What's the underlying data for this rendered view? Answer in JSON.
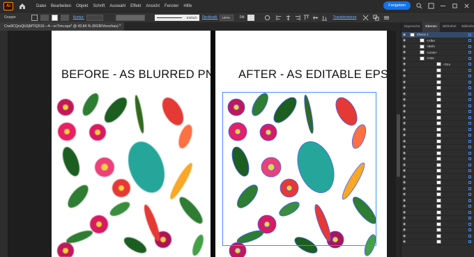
{
  "app": {
    "logo": "Ai"
  },
  "menu": [
    "Datei",
    "Bearbeiten",
    "Objekt",
    "Schrift",
    "Auswahl",
    "Effekt",
    "Ansicht",
    "Fenster",
    "Hilfe"
  ],
  "toolbar_right": {
    "share_label": "Freigeben"
  },
  "control": {
    "group_label": "Gruppe",
    "contour_label": "Kontur:",
    "stroke_label": "Einfach",
    "opacity_label": "Deckkraft:",
    "opacity_value": "100%",
    "style_label": "Stil:",
    "transform_label": "Transformieren"
  },
  "document": {
    "tab_title": "Crw9CQrsQiUIjMTIQ516---4---vcTmv.eps* @ 43.84 % (RGB/Vorschau)",
    "close": "×"
  },
  "artboards": {
    "left_title": "BEFORE - AS BLURRED PNG",
    "right_title": "AFTER - AS EDITABLE EPS"
  },
  "panel": {
    "tabs": [
      "Eigenscha",
      "Ebenen",
      "Bibliothel",
      "Bibliothe"
    ],
    "active_tab": 1,
    "layers": [
      {
        "label": "Ebene 1",
        "top": true
      },
      {
        "label": "<After"
      },
      {
        "label": "<Befo"
      },
      {
        "label": "<Linie>"
      },
      {
        "label": "<Hint"
      },
      {
        "label": "<Gru"
      },
      {
        "label": ""
      },
      {
        "label": ""
      },
      {
        "label": ""
      },
      {
        "label": ""
      },
      {
        "label": ""
      },
      {
        "label": ""
      },
      {
        "label": ""
      },
      {
        "label": ""
      },
      {
        "label": ""
      },
      {
        "label": ""
      },
      {
        "label": ""
      },
      {
        "label": ""
      },
      {
        "label": ""
      },
      {
        "label": ""
      },
      {
        "label": ""
      },
      {
        "label": ""
      },
      {
        "label": ""
      },
      {
        "label": ""
      },
      {
        "label": ""
      },
      {
        "label": ""
      },
      {
        "label": ""
      },
      {
        "label": ""
      },
      {
        "label": ""
      },
      {
        "label": ""
      },
      {
        "label": ""
      },
      {
        "label": ""
      },
      {
        "label": ""
      },
      {
        "label": ""
      },
      {
        "label": ""
      },
      {
        "label": ""
      }
    ]
  },
  "colors": {
    "accent": "#1473e6",
    "selection": "#3f8cff",
    "app_orange": "#ff9a00"
  }
}
